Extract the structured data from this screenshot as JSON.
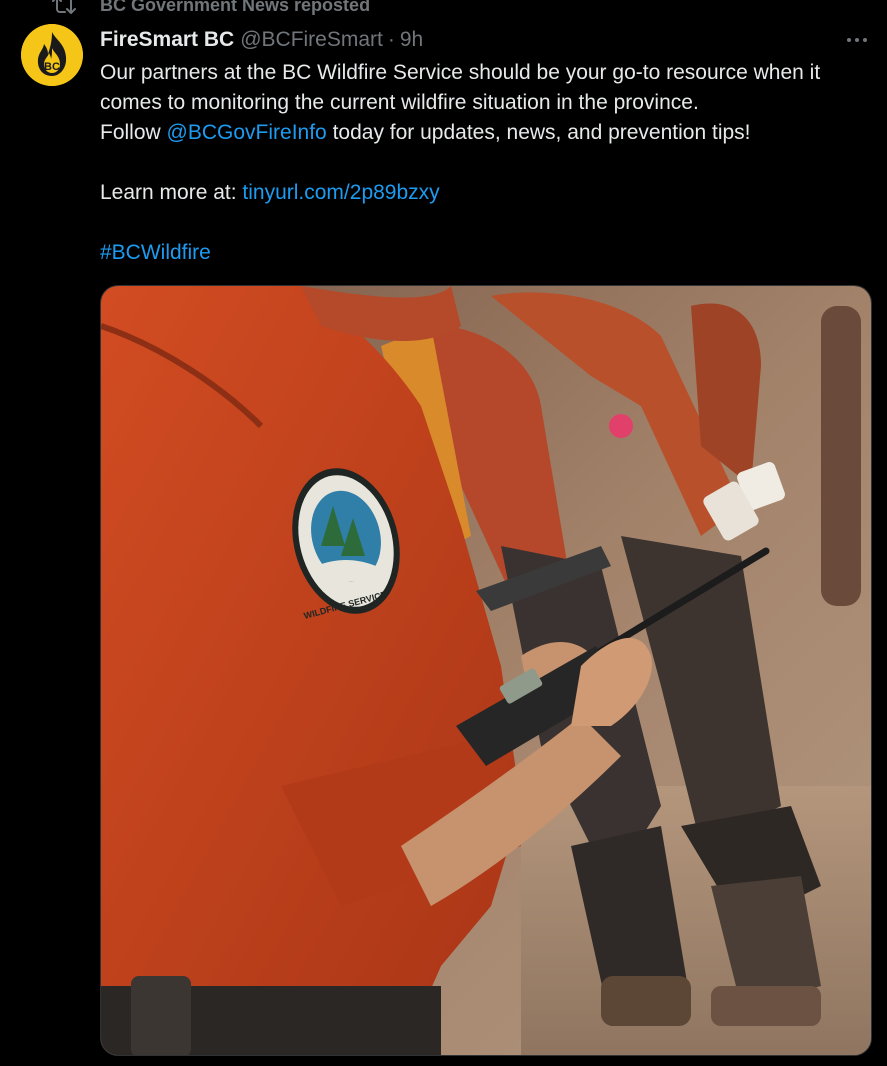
{
  "repost": {
    "label": "BC Government News reposted"
  },
  "author": {
    "display_name": "FireSmart BC",
    "handle": "@BCFireSmart",
    "separator": "·",
    "time": "9h",
    "avatar_initials": "BC"
  },
  "tweet": {
    "line1": "Our partners at the BC Wildfire Service should be your go-to resource when it comes to monitoring the current wildfire situation in the province.",
    "follow_prefix": "Follow ",
    "mention": "@BCGovFireInfo",
    "follow_suffix": " today for updates, news, and prevention tips!",
    "learn_prefix": "Learn more at: ",
    "learn_link": "tinyurl.com/2p89bzxy",
    "hashtag": "#BCWildfire"
  },
  "media": {
    "patch_text": "WILDFIRE SERVICE"
  },
  "colors": {
    "background": "#000000",
    "text": "#e7e9ea",
    "muted": "#71767b",
    "link": "#1d9bf0",
    "avatar": "#f5c518",
    "shirt": "#c2431f"
  },
  "icons": {
    "repost": "repost-icon",
    "more": "more-icon",
    "flame": "flame-icon"
  }
}
